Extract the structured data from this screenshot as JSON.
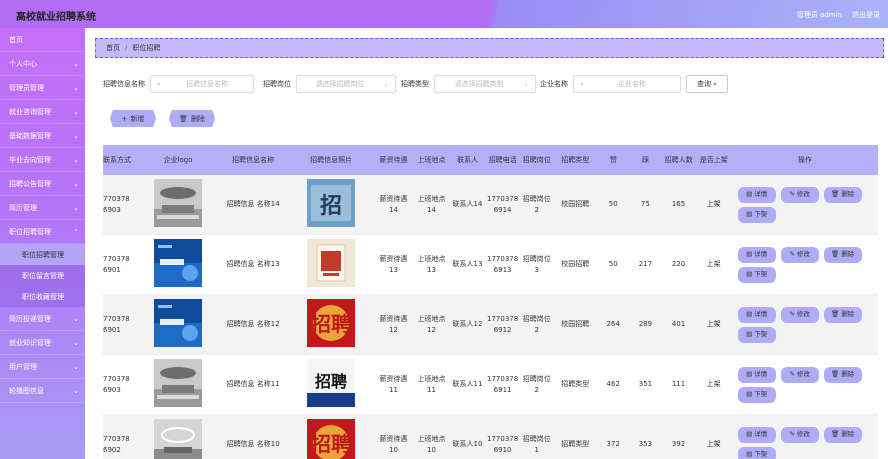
{
  "header": {
    "title": "高校就业招聘系统",
    "admin_label": "管理员 admin",
    "logout_label": "退出登录"
  },
  "sidebar": {
    "items": [
      {
        "label": "首页",
        "chevron": false
      },
      {
        "label": "个人中心",
        "chevron": true
      },
      {
        "label": "管理员管理",
        "chevron": true
      },
      {
        "label": "就业咨询管理",
        "chevron": true
      },
      {
        "label": "基础数据管理",
        "chevron": true
      },
      {
        "label": "毕业去向管理",
        "chevron": true
      },
      {
        "label": "招聘公告管理",
        "chevron": true
      },
      {
        "label": "简历管理",
        "chevron": true
      },
      {
        "label": "职位招聘管理",
        "chevron": true
      }
    ],
    "sub_items": [
      {
        "label": "职位招聘管理",
        "active": true
      },
      {
        "label": "职位留言管理",
        "active": false
      },
      {
        "label": "职位收藏管理",
        "active": false
      }
    ],
    "items_after": [
      {
        "label": "简历投递管理",
        "chevron": true
      },
      {
        "label": "就业知识管理",
        "chevron": true
      },
      {
        "label": "用户管理",
        "chevron": true
      },
      {
        "label": "轮播图信息",
        "chevron": true
      }
    ]
  },
  "breadcrumb": {
    "home": "首页",
    "sep": "/",
    "current": "职位招聘"
  },
  "filters": {
    "name_label": "招聘信息名称",
    "name_placeholder": "招聘信息名称",
    "position_label": "招聘岗位",
    "position_placeholder": "请选择招聘岗位",
    "type_label": "招聘类型",
    "type_placeholder": "请选择招聘类型",
    "company_label": "企业名称",
    "company_placeholder": "企业名称",
    "query_label": "查询"
  },
  "actions": {
    "add_label": "新增",
    "delete_label": "删除"
  },
  "table": {
    "headers": [
      "联系方式",
      "企业logo",
      "招聘信息名称",
      "招聘信息照片",
      "薪资待遇",
      "上班地点",
      "联系人",
      "招聘电话",
      "招聘岗位",
      "招聘类型",
      "赞",
      "踩",
      "招聘人数",
      "是否上架",
      "操作"
    ],
    "ops": {
      "detail": "详情",
      "edit": "修改",
      "delete": "删除",
      "offshelf": "下架"
    },
    "rows": [
      {
        "phone": "770378 6903",
        "logo": "office-grey",
        "name": "招聘信息 名称14",
        "photo": "blue-recruit",
        "salary": "薪资待遇 14",
        "location": "上班地点 14",
        "contact": "联系人14",
        "tel": "1770378 6914",
        "position": "招聘岗位 2",
        "type": "校园招聘",
        "like": "50",
        "dislike": "75",
        "count": "165",
        "status": "上架"
      },
      {
        "phone": "770378 6901",
        "logo": "blue-company",
        "name": "招聘信息 名称13",
        "photo": "poster-red",
        "salary": "薪资待遇 13",
        "location": "上班地点 13",
        "contact": "联系人13",
        "tel": "1770378 6913",
        "position": "招聘岗位 3",
        "type": "校园招聘",
        "like": "50",
        "dislike": "217",
        "count": "220",
        "status": "上架"
      },
      {
        "phone": "770378 6901",
        "logo": "blue-company",
        "name": "招聘信息 名称12",
        "photo": "red-recruit",
        "salary": "薪资待遇 12",
        "location": "上班地点 12",
        "contact": "联系人12",
        "tel": "1770378 6912",
        "position": "招聘岗位 2",
        "type": "校园招聘",
        "like": "264",
        "dislike": "289",
        "count": "401",
        "status": "上架"
      },
      {
        "phone": "770378 6903",
        "logo": "office-grey",
        "name": "招聘信息 名称11",
        "photo": "navy-recruit",
        "salary": "薪资待遇 11",
        "location": "上班地点 11",
        "contact": "联系人11",
        "tel": "1770378 6911",
        "position": "招聘岗位 2",
        "type": "招聘类型",
        "like": "462",
        "dislike": "351",
        "count": "111",
        "status": "上架"
      },
      {
        "phone": "770378 6902",
        "logo": "office-ceiling",
        "name": "招聘信息 名称10",
        "photo": "red-recruit",
        "salary": "薪资待遇 10",
        "location": "上班地点 10",
        "contact": "联系人10",
        "tel": "1770378 6910",
        "position": "招聘岗位 1",
        "type": "招聘类型",
        "like": "372",
        "dislike": "353",
        "count": "392",
        "status": "上架"
      }
    ]
  },
  "colors": {
    "accent": "#b26df7",
    "button": "#b0abf7",
    "table_header": "#b6aef9",
    "breadcrumb_bg": "#c5b9fb"
  }
}
